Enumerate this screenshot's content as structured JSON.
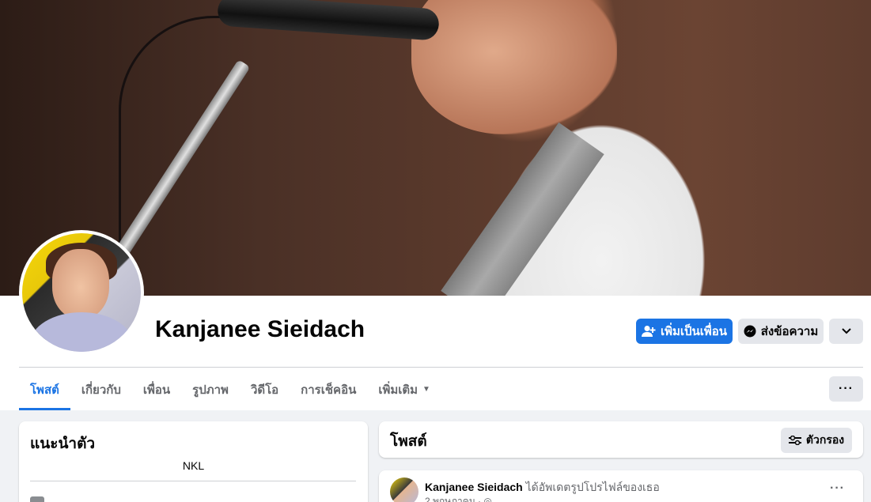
{
  "profile": {
    "name": "Kanjanee Sieidach"
  },
  "actions": {
    "add_friend": "เพิ่มเป็นเพื่อน",
    "message": "ส่งข้อความ",
    "more_icon": "chevron-down-icon"
  },
  "tabs": [
    {
      "label": "โพสต์",
      "active": true
    },
    {
      "label": "เกี่ยวกับ",
      "active": false
    },
    {
      "label": "เพื่อน",
      "active": false
    },
    {
      "label": "รูปภาพ",
      "active": false
    },
    {
      "label": "วิดีโอ",
      "active": false
    },
    {
      "label": "การเช็คอิน",
      "active": false
    },
    {
      "label": "เพิ่มเติม",
      "active": false
    }
  ],
  "tabs_more_label": "···",
  "intro": {
    "title": "แนะนำตัว",
    "bio": "NKL"
  },
  "posts": {
    "title": "โพสต์",
    "filter_label": "ตัวกรอง"
  },
  "post": {
    "author": "Kanjanee Sieidach",
    "action": "ได้อัพเดตรูปโปรไฟล์ของเธอ",
    "date": "2 พฤษภาคม",
    "menu": "···"
  },
  "colors": {
    "accent": "#1b74e4",
    "background": "#f0f2f5"
  }
}
